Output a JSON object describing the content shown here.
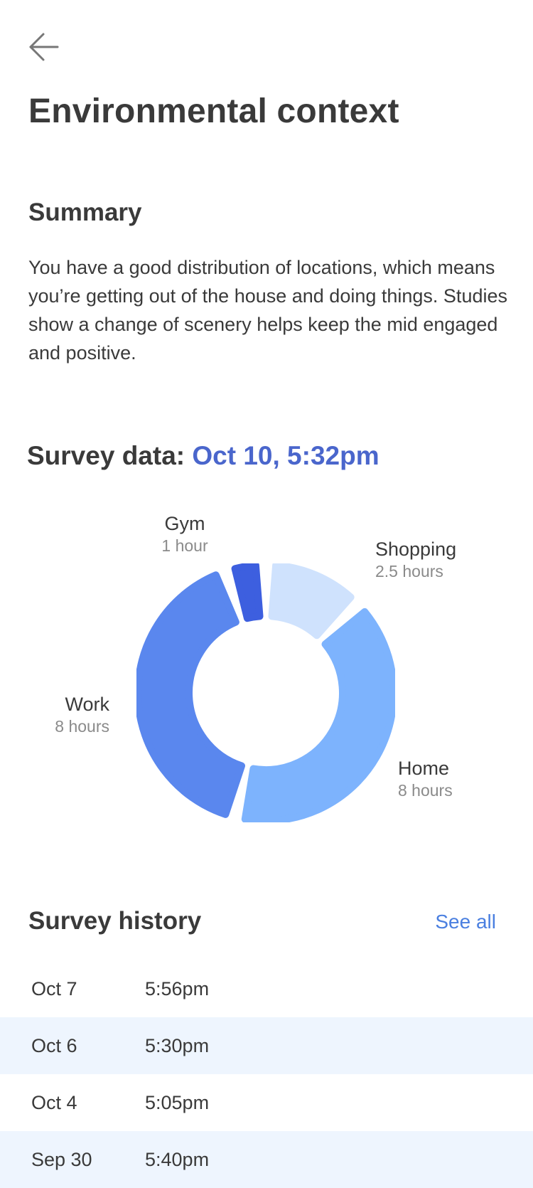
{
  "header": {
    "title": "Environmental context"
  },
  "summary": {
    "heading": "Summary",
    "body": "You have a good distribution of locations, which means you’re getting out of the house and doing things. Studies show a change of scenery helps keep the mid engaged and positive."
  },
  "survey": {
    "label": "Survey data:",
    "datetime": "Oct 10, 5:32pm"
  },
  "chart_data": {
    "type": "pie",
    "donut": true,
    "categories": [
      "Gym",
      "Shopping",
      "Home",
      "Work"
    ],
    "values": [
      1,
      2.5,
      8,
      8
    ],
    "units": [
      "1 hour",
      "2.5 hours",
      "8 hours",
      "8 hours"
    ],
    "colors": [
      "#3d5fdf",
      "#cfe2fd",
      "#7db3fd",
      "#5a87ee"
    ]
  },
  "history": {
    "heading": "Survey history",
    "see_all": "See all",
    "rows": [
      {
        "date": "Oct 7",
        "time": "5:56pm"
      },
      {
        "date": "Oct 6",
        "time": "5:30pm"
      },
      {
        "date": "Oct 4",
        "time": "5:05pm"
      },
      {
        "date": "Sep 30",
        "time": "5:40pm"
      }
    ]
  }
}
